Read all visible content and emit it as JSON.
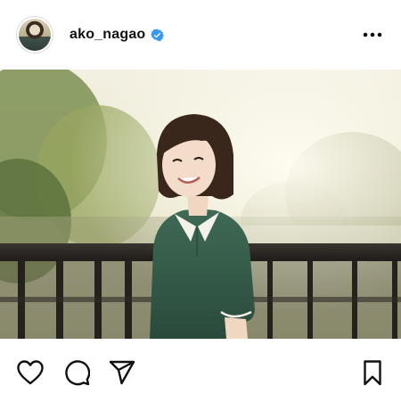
{
  "post": {
    "username": "ako_nagao",
    "verified": true,
    "icons": {
      "verified": "verified-badge-icon",
      "more": "more-options-icon",
      "like": "heart-icon",
      "comment": "comment-bubble-icon",
      "share": "paper-plane-icon",
      "save": "bookmark-icon"
    },
    "colors": {
      "verified_badge": "#3897f0",
      "icon_stroke": "#111111",
      "background": "#ffffff"
    }
  }
}
